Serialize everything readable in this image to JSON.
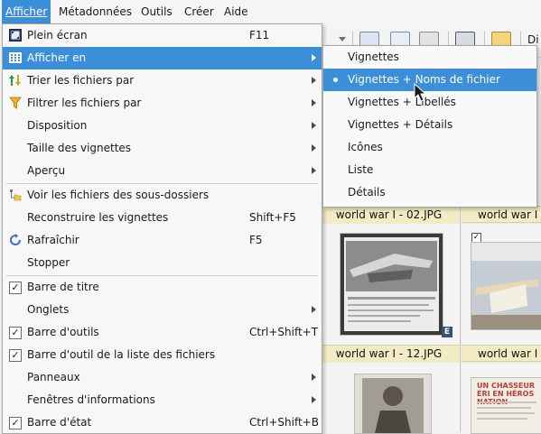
{
  "menubar": {
    "items": [
      {
        "label": "Afficher",
        "active": true
      },
      {
        "label": "Métadonnées",
        "active": false
      },
      {
        "label": "Outils",
        "active": false
      },
      {
        "label": "Créer",
        "active": false
      },
      {
        "label": "Aide",
        "active": false
      }
    ]
  },
  "toolbar": {
    "partial_text": "Di"
  },
  "menu": {
    "items": [
      {
        "label": "Plein écran",
        "shortcut": "F11",
        "icon": "fullscreen-icon",
        "highlighted": false
      },
      {
        "label": "Afficher en",
        "submenu": true,
        "icon": "grid-view-icon",
        "highlighted": true
      },
      {
        "label": "Trier les fichiers par",
        "submenu": true,
        "icon": "sort-icon"
      },
      {
        "label": "Filtrer les fichiers par",
        "submenu": true,
        "icon": "filter-icon"
      },
      {
        "label": "Disposition",
        "submenu": true
      },
      {
        "label": "Taille des vignettes",
        "submenu": true
      },
      {
        "label": "Aperçu",
        "submenu": true
      },
      {
        "label": "Voir les fichiers des sous-dossiers",
        "icon": "subfolder-icon"
      },
      {
        "label": "Reconstruire les vignettes",
        "shortcut": "Shift+F5"
      },
      {
        "label": "Rafraîchir",
        "shortcut": "F5",
        "icon": "refresh-icon"
      },
      {
        "label": "Stopper"
      },
      {
        "label": "Barre de titre",
        "checked": true
      },
      {
        "label": "Onglets",
        "submenu": true
      },
      {
        "label": "Barre d'outils",
        "shortcut": "Ctrl+Shift+T",
        "checked": true
      },
      {
        "label": "Barre d'outil de la liste des fichiers",
        "checked": true
      },
      {
        "label": "Panneaux",
        "submenu": true
      },
      {
        "label": "Fenêtres d'informations",
        "submenu": true
      },
      {
        "label": "Barre d'état",
        "shortcut": "Ctrl+Shift+B",
        "checked": true
      }
    ]
  },
  "submenu": {
    "items": [
      {
        "label": "Vignettes"
      },
      {
        "label": "Vignettes + Noms de fichier",
        "selected": true
      },
      {
        "label": "Vignettes + Libellés"
      },
      {
        "label": "Vignettes + Détails"
      },
      {
        "label": "Icônes"
      },
      {
        "label": "Liste"
      },
      {
        "label": "Détails"
      }
    ]
  },
  "thumbnails": {
    "captions": [
      "world war I - 02.JPG",
      "world war I -",
      "world war I - 12.JPG",
      "world war I -"
    ],
    "badge": "E",
    "poster_text": "UN CHASSEUR ÉRI EN HÉROS NATION"
  },
  "colors": {
    "highlight": "#3b8fd9",
    "caption_bg": "#f2ebc4",
    "menu_bg": "#f7f7f7"
  }
}
